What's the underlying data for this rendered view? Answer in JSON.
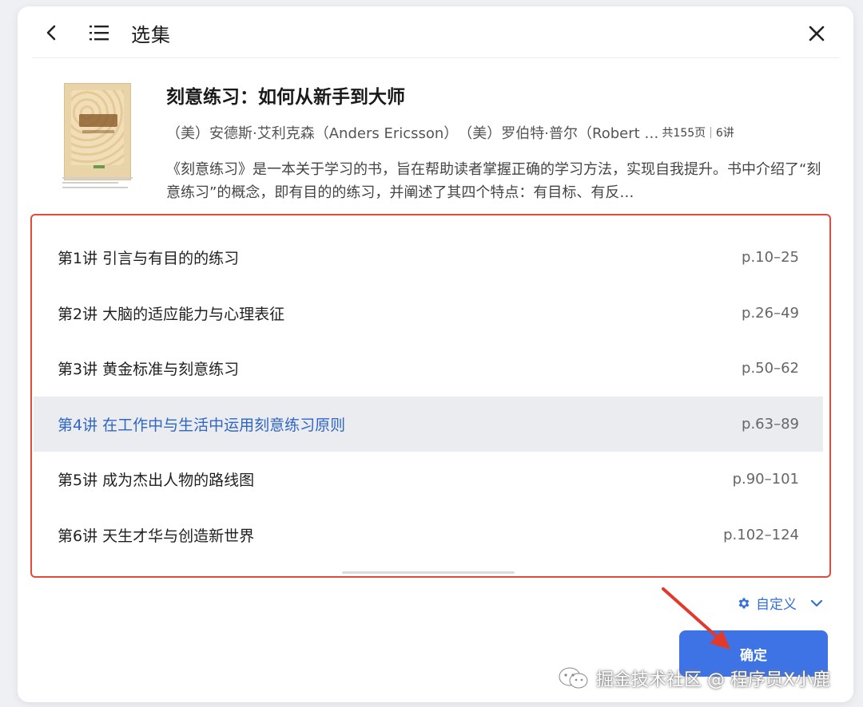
{
  "header": {
    "title": "选集"
  },
  "book": {
    "title": "刻意练习：如何从新手到大师",
    "authors": "（美）安德斯·艾利克森（Anders Ericsson）　（美）罗伯特·普尔（Robert …",
    "page_count": "共155页",
    "lecture_count": "6讲",
    "description": "《刻意练习》是一本关于学习的书，旨在帮助读者掌握正确的学习方法，实现自我提升。书中介绍了“刻意练习”的概念，即有目的的练习，并阐述了其四个特点：有目标、有反…"
  },
  "lectures": [
    {
      "label": "第1讲 引言与有目的的练习",
      "pages": "p.10–25",
      "active": false
    },
    {
      "label": "第2讲 大脑的适应能力与心理表征",
      "pages": "p.26–49",
      "active": false
    },
    {
      "label": "第3讲 黄金标准与刻意练习",
      "pages": "p.50–62",
      "active": false
    },
    {
      "label": "第4讲 在工作中与生活中运用刻意练习原则",
      "pages": "p.63–89",
      "active": true
    },
    {
      "label": "第5讲 成为杰出人物的路线图",
      "pages": "p.90–101",
      "active": false
    },
    {
      "label": "第6讲 天生才华与创造新世界",
      "pages": "p.102–124",
      "active": false
    }
  ],
  "custom": {
    "label": "自定义"
  },
  "confirm": {
    "label": "确定"
  },
  "watermark": {
    "text": "掘金技术社区 @ 程序员X小鹿"
  },
  "colors": {
    "accent": "#3e73e6",
    "active_text": "#2f66c4",
    "highlight_border": "#e24a3c"
  },
  "icons": [
    "back-arrow-icon",
    "list-icon",
    "close-icon",
    "gear-icon",
    "chevron-down-icon",
    "wechat-icon"
  ]
}
